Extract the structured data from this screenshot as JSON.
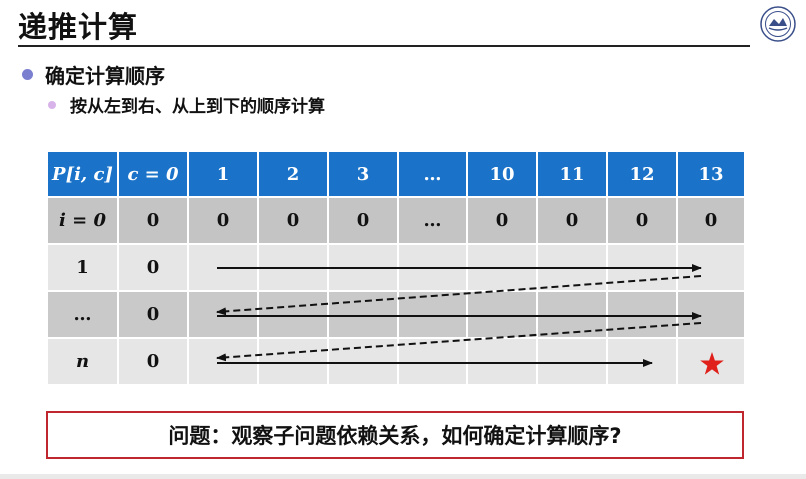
{
  "header": {
    "title": "递推计算"
  },
  "bullets": {
    "main": "确定计算顺序",
    "sub": "按从左到右、从上到下的顺序计算"
  },
  "table": {
    "header_cells": [
      "P[i, c]",
      "c = 0",
      "1",
      "2",
      "3",
      "…",
      "10",
      "11",
      "12",
      "13"
    ],
    "rows": [
      {
        "label": "i = 0",
        "cells": [
          "0",
          "0",
          "0",
          "0",
          "…",
          "0",
          "0",
          "0",
          "0"
        ]
      },
      {
        "label": "1",
        "cells": [
          "0"
        ]
      },
      {
        "label": "…",
        "cells": [
          "0"
        ]
      },
      {
        "label": "n",
        "cells": [
          "0"
        ]
      }
    ],
    "target_icon": "star-icon",
    "target_color": "#e0201b"
  },
  "question": "问题：观察子问题依赖关系，如何确定计算顺序?",
  "colors": {
    "header_blue": "#1a73c9",
    "question_border": "#c0262e",
    "bullet_main": "#7a7fd0",
    "bullet_sub": "#d7b3ea"
  }
}
